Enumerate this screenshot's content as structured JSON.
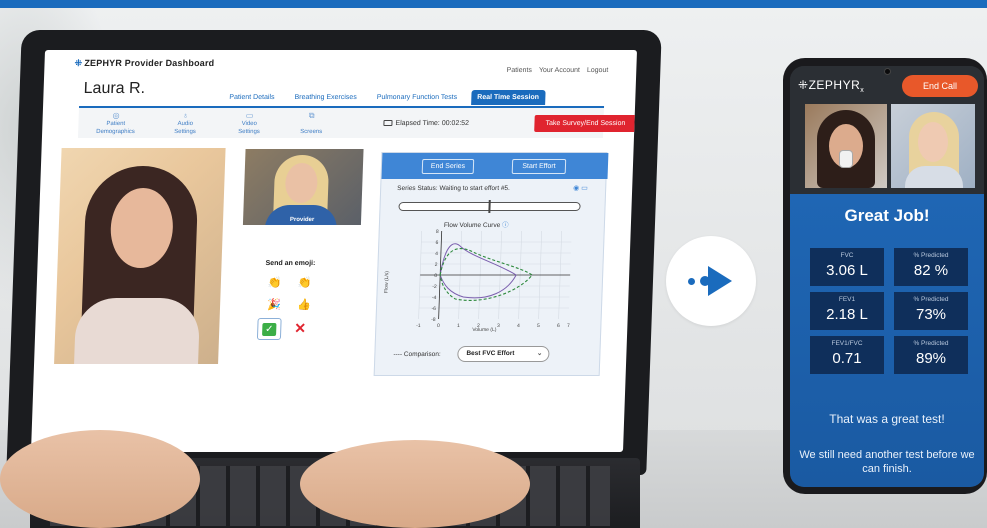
{
  "dashboard": {
    "brand": "ZEPHYR",
    "brand_suffix": "Provider Dashboard",
    "top_nav": [
      "Patients",
      "Your Account",
      "Logout"
    ],
    "patient_name": "Laura R.",
    "tabs": [
      {
        "label": "Patient Details",
        "active": false
      },
      {
        "label": "Breathing Exercises",
        "active": false
      },
      {
        "label": "Pulmonary Function Tests",
        "active": false
      },
      {
        "label": "Real Time Session",
        "active": true
      }
    ],
    "toolbar": [
      {
        "icon": "user-icon",
        "line1": "Patient",
        "line2": "Demographics"
      },
      {
        "icon": "microphone-icon",
        "line1": "Audio",
        "line2": "Settings"
      },
      {
        "icon": "video-icon",
        "line1": "Video",
        "line2": "Settings"
      },
      {
        "icon": "screen-icon",
        "line1": "",
        "line2": "Screens"
      }
    ],
    "elapsed_label": "Elapsed Time: 00:02:52",
    "survey_button": "Take Survey/End Session",
    "provider_label": "Provider",
    "emoji_title": "Send an emoji:",
    "emojis": [
      "👏",
      "👏",
      "🎉",
      "👍"
    ],
    "flow": {
      "end_series": "End Series",
      "start_effort": "Start Effort",
      "series_status": "Series Status: Waiting to start effort #5.",
      "curve_title": "Flow Volume Curve",
      "ylabel": "Flow (L/s)",
      "xlabel": "Volume (L)",
      "y_ticks": [
        "8",
        "6",
        "4",
        "2",
        "0",
        "-2",
        "-4",
        "-6",
        "-8"
      ],
      "x_ticks": [
        "-1",
        "0",
        "1",
        "2",
        "3",
        "4",
        "5",
        "6",
        "7"
      ],
      "comparison_label": "Comparison:",
      "comparison_value": "Best FVC Effort"
    }
  },
  "phone": {
    "brand": "ZEPHYR",
    "brand_sub": "x",
    "end_call": "End Call",
    "headline": "Great Job!",
    "stats": [
      {
        "label": "FVC",
        "value": "3.06 L"
      },
      {
        "label": "% Predicted",
        "value": "82 %"
      },
      {
        "label": "FEV1",
        "value": "2.18 L"
      },
      {
        "label": "% Predicted",
        "value": "73%"
      },
      {
        "label": "FEV1/FVC",
        "value": "0.71"
      },
      {
        "label": "% Predicted",
        "value": "89%"
      }
    ],
    "message1": "That was a great test!",
    "message2": "We still need another test before we can finish."
  },
  "colors": {
    "brand_blue": "#1a6bbd",
    "end_call": "#e8582a",
    "survey_red": "#e0242f",
    "phone_panel": "#1f66b4"
  }
}
